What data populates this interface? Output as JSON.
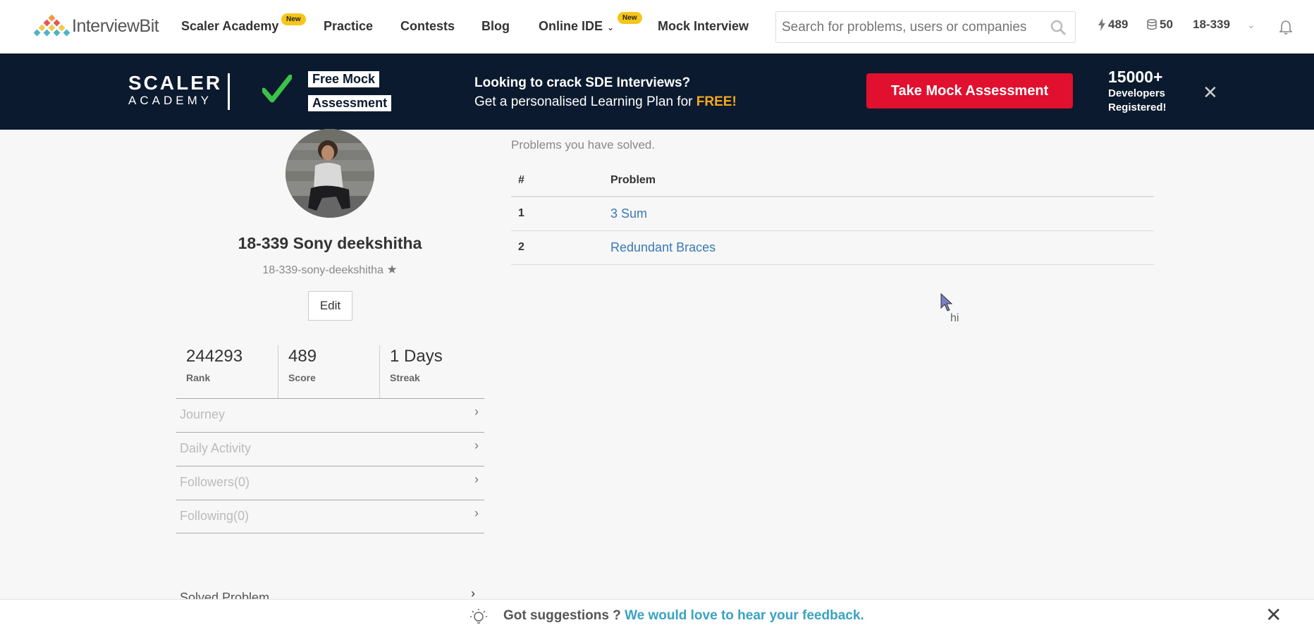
{
  "nav": {
    "logo_text": "InterviewBit",
    "items": [
      {
        "label": "Scaler Academy",
        "badge": "New"
      },
      {
        "label": "Practice"
      },
      {
        "label": "Contests"
      },
      {
        "label": "Blog"
      },
      {
        "label": "Online IDE",
        "badge": "New"
      },
      {
        "label": "Mock Interview"
      }
    ],
    "search_placeholder": "Search for problems, users or companies",
    "score": "489",
    "coins": "50",
    "username": "18-339"
  },
  "banner": {
    "brand_line1": "SCALER",
    "brand_line2": "ACADEMY",
    "tag1": "Free Mock",
    "tag2": "Assessment",
    "headline": "Looking to crack SDE Interviews?",
    "subline": "Get a personalised Learning Plan for ",
    "subline_highlight": "FREE!",
    "cta": "Take Mock Assessment",
    "dev_count": "15000+",
    "dev_label1": "Developers",
    "dev_label2": "Registered!",
    "accent_color": "#e0102e",
    "background_color": "#0b1a2e"
  },
  "profile": {
    "name": "18-339 Sony deekshitha",
    "handle": "18-339-sony-deekshitha",
    "edit_label": "Edit",
    "stats": [
      {
        "value": "244293",
        "label": "Rank"
      },
      {
        "value": "489",
        "label": "Score"
      },
      {
        "value": "1 Days",
        "label": "Streak"
      }
    ],
    "menu": [
      "Journey",
      "Daily Activity",
      "Followers(0)",
      "Following(0)"
    ],
    "solved_label": "Solved Problem"
  },
  "problems": {
    "caption": "Problems you have solved.",
    "columns": [
      "#",
      "Problem"
    ],
    "rows": [
      {
        "num": "1",
        "name": "3 Sum"
      },
      {
        "num": "2",
        "name": "Redundant Braces"
      }
    ]
  },
  "cursor_tooltip": "hi",
  "feedback": {
    "prompt": "Got suggestions ? ",
    "link": "We would love to hear your feedback."
  }
}
